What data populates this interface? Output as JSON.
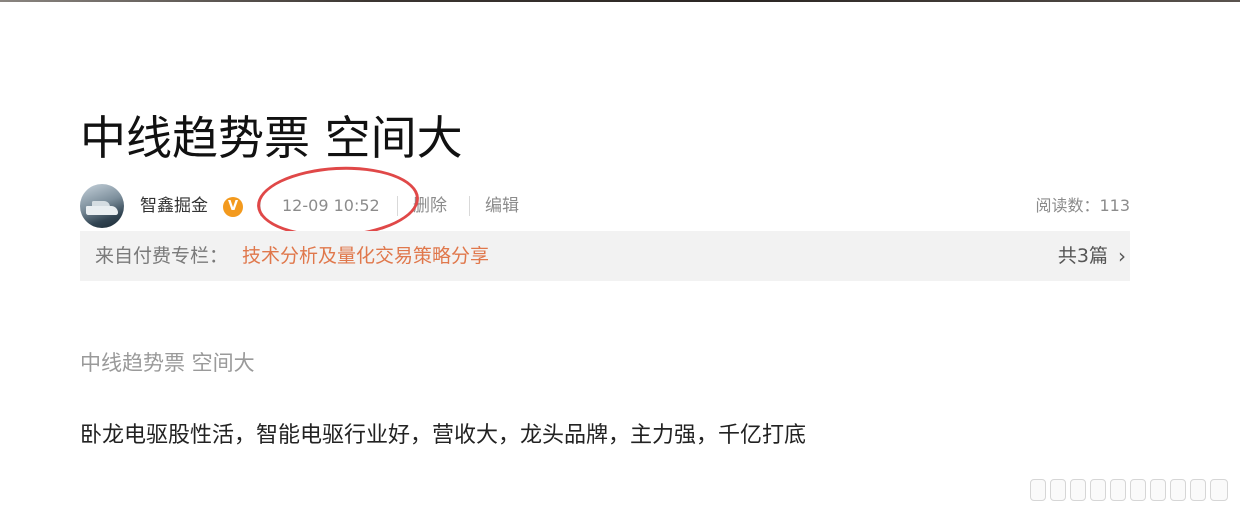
{
  "article": {
    "title": "中线趋势票 空间大",
    "summary": "中线趋势票 空间大",
    "body": "卧龙电驱股性活，智能电驱行业好，营收大，龙头品牌，主力强，千亿打底"
  },
  "meta": {
    "author": "智鑫掘金",
    "verified_badge": "V",
    "time": "12-09 10:52",
    "delete_label": "删除",
    "edit_label": "编辑",
    "reads_label": "阅读数：113"
  },
  "column": {
    "prefix": "来自付费专栏：",
    "name": "技术分析及量化交易策略分享",
    "count": "共3篇",
    "chevron": "›"
  },
  "colors": {
    "accent": "#e0784c",
    "badge": "#f39a1e",
    "highlight": "#e04848"
  }
}
